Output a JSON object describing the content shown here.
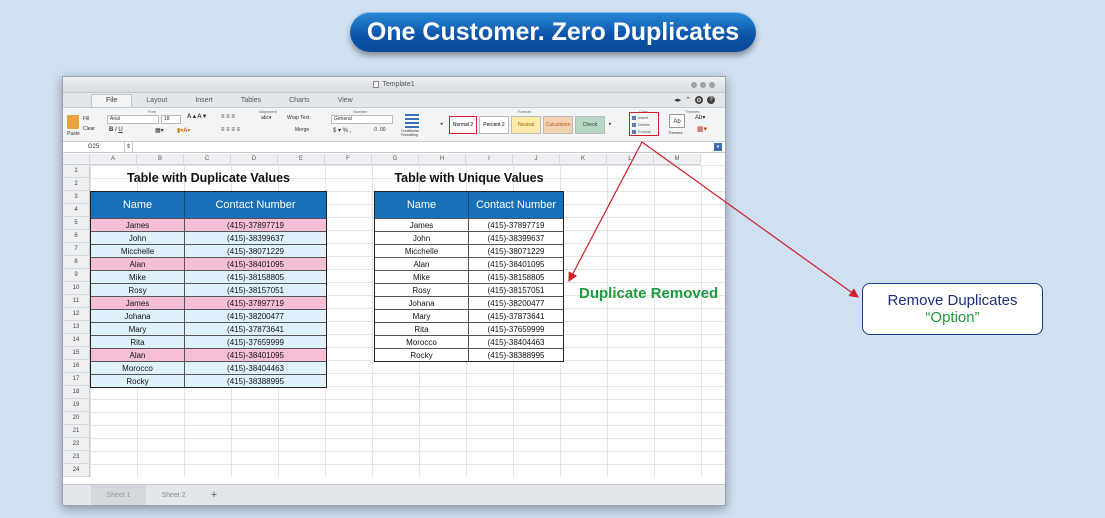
{
  "banner": {
    "title": "One Customer. Zero Duplicates"
  },
  "window": {
    "doc_title": "Template1",
    "tabs": [
      "File",
      "Layout",
      "Insert",
      "Tables",
      "Charts",
      "View"
    ],
    "active_tab": "File"
  },
  "ribbon": {
    "groups": {
      "font": "Font",
      "alignment": "Alignment",
      "number": "Number",
      "format": "Format",
      "cells": "Cells",
      "themes": "Themes"
    },
    "paste": "Paste",
    "fill": "Fill",
    "clear": "Clear",
    "font_name": "Arial",
    "font_size": "18",
    "wrap_text": "Wrap Text",
    "merge": "Merge",
    "number_format": "General",
    "conditional_formatting": "Conditional Formatting",
    "styles": [
      "Normal 2",
      "Percent 2",
      "Neutral",
      "Calculation",
      "Check"
    ],
    "cells_items": [
      "Insert",
      "Delete",
      "Format"
    ],
    "themes_label": "Themes"
  },
  "formula_bar": {
    "cell_ref": "G25"
  },
  "columns": [
    "A",
    "B",
    "C",
    "D",
    "E",
    "F",
    "G",
    "H",
    "I",
    "J",
    "K",
    "L",
    "M"
  ],
  "rows": [
    "1",
    "2",
    "3",
    "4",
    "5",
    "6",
    "7",
    "8",
    "9",
    "10",
    "11",
    "12",
    "13",
    "14",
    "15",
    "16",
    "17",
    "18",
    "19",
    "20",
    "21",
    "22",
    "23",
    "24"
  ],
  "dup_table": {
    "title": "Table with Duplicate Values",
    "headers": [
      "Name",
      "Contact Number"
    ],
    "rows": [
      {
        "name": "James",
        "contact": "(415)-37897719",
        "dup": true
      },
      {
        "name": "John",
        "contact": "(415)-38399637",
        "dup": false
      },
      {
        "name": "Micchelle",
        "contact": "(415)-38071229",
        "dup": false
      },
      {
        "name": "Alan",
        "contact": "(415)-38401095",
        "dup": true
      },
      {
        "name": "Mike",
        "contact": "(415)-38158805",
        "dup": false
      },
      {
        "name": "Rosy",
        "contact": "(415)-38157051",
        "dup": false
      },
      {
        "name": "James",
        "contact": "(415)-37897719",
        "dup": true
      },
      {
        "name": "Johana",
        "contact": "(415)-38200477",
        "dup": false
      },
      {
        "name": "Mary",
        "contact": "(415)-37873641",
        "dup": false
      },
      {
        "name": "Rita",
        "contact": "(415)-37659999",
        "dup": false
      },
      {
        "name": "Alan",
        "contact": "(415)-38401095",
        "dup": true
      },
      {
        "name": "Morocco",
        "contact": "(415)-38404463",
        "dup": false
      },
      {
        "name": "Rocky",
        "contact": "(415)-38388995",
        "dup": false
      }
    ]
  },
  "unique_table": {
    "title": "Table with Unique Values",
    "headers": [
      "Name",
      "Contact Number"
    ],
    "rows": [
      {
        "name": "James",
        "contact": "(415)-37897719"
      },
      {
        "name": "John",
        "contact": "(415)-38399637"
      },
      {
        "name": "Micchelle",
        "contact": "(415)-38071229"
      },
      {
        "name": "Alan",
        "contact": "(415)-38401095"
      },
      {
        "name": "Mike",
        "contact": "(415)-38158805"
      },
      {
        "name": "Rosy",
        "contact": "(415)-38157051"
      },
      {
        "name": "Johana",
        "contact": "(415)-38200477"
      },
      {
        "name": "Mary",
        "contact": "(415)-37873641"
      },
      {
        "name": "Rita",
        "contact": "(415)-37659999"
      },
      {
        "name": "Morocco",
        "contact": "(415)-38404463"
      },
      {
        "name": "Rocky",
        "contact": "(415)-38388995"
      }
    ]
  },
  "sheets": [
    "Sheet 1",
    "Sheet 2"
  ],
  "annotations": {
    "duplicate_removed": "Duplicate Removed",
    "callout_line1": "Remove Duplicates",
    "callout_line2": "“Option”"
  },
  "colors": {
    "header_blue": "#1770b8",
    "duplicate_pink": "#f7bfd7",
    "row_light_blue": "#dff1fb",
    "annotation_green": "#1c9b3c",
    "arrow_red": "#d0202a"
  }
}
